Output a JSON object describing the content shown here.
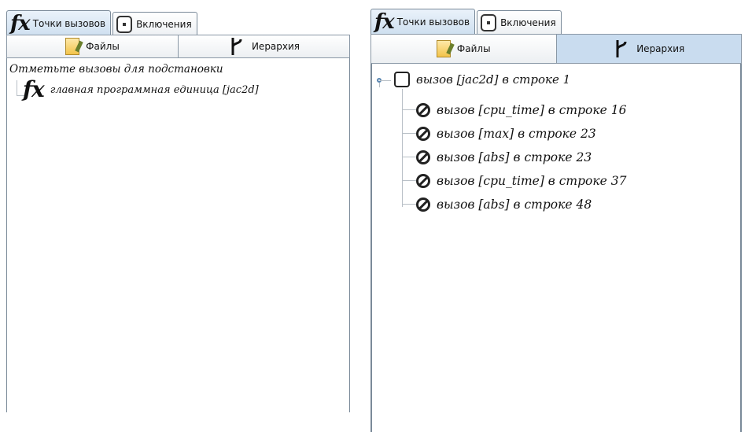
{
  "left": {
    "tabs": [
      {
        "label": "Точки вызовов",
        "icon": "fx-icon"
      },
      {
        "label": "Включения",
        "icon": "document-icon"
      }
    ],
    "subtabs": [
      {
        "label": "Файлы",
        "icon": "files-icon"
      },
      {
        "label": "Иерархия",
        "icon": "fork-icon"
      }
    ],
    "hint": "Отметьте вызовы для подстановки",
    "root_label": "главная программная единица [jac2d]"
  },
  "right": {
    "tabs": [
      {
        "label": "Точки вызовов",
        "icon": "fx-icon"
      },
      {
        "label": "Включения",
        "icon": "document-icon"
      }
    ],
    "subtabs": [
      {
        "label": "Файлы",
        "icon": "files-icon"
      },
      {
        "label": "Иерархия",
        "icon": "fork-icon"
      }
    ],
    "root_call": "вызов [jac2d] в строке 1",
    "calls": [
      "вызов [cpu_time] в строке 16",
      "вызов [max] в строке 23",
      "вызов [abs] в строке 23",
      "вызов [cpu_time] в строке 37",
      "вызов [abs] в строке 48"
    ]
  }
}
